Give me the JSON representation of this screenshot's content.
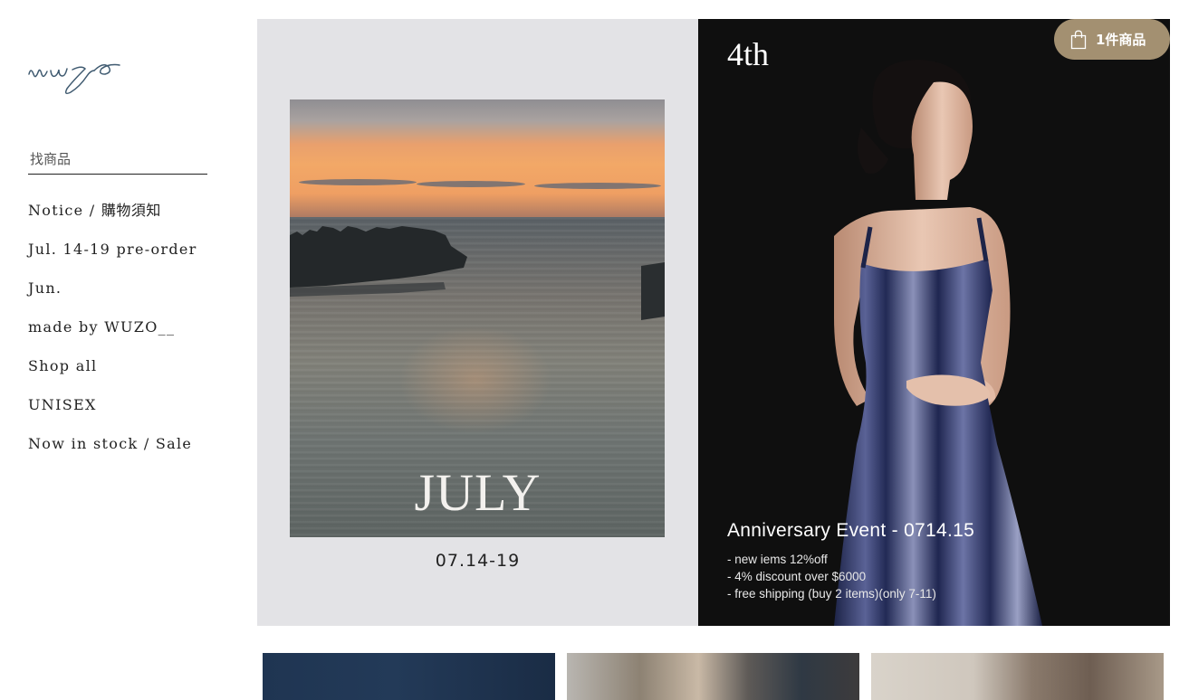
{
  "brand": {
    "logo_text": "wuzo"
  },
  "search": {
    "placeholder": "找商品"
  },
  "nav": {
    "items": [
      {
        "label": "Notice / ",
        "label_cjk": "購物須知"
      },
      {
        "label": "Jul. 14-19 pre-order"
      },
      {
        "label": "Jun."
      },
      {
        "label": "made by WUZO__"
      },
      {
        "label": "Shop all"
      },
      {
        "label": "UNISEX"
      },
      {
        "label": "Now in stock / Sale"
      }
    ]
  },
  "cart": {
    "label": "1件商品",
    "icon": "shopping-bag-icon",
    "color": "#a39071"
  },
  "hero": {
    "left": {
      "title": "JULY",
      "date": "07.14-19",
      "background": "#e3e3e6"
    },
    "right": {
      "badge": "4th",
      "event_title": "Anniversary Event  - 0714.15",
      "bullets": [
        "- new iems 12%off",
        "- 4% discount over $6000",
        "- free shipping (buy 2 items)(only 7-11)"
      ]
    }
  },
  "products": [
    {
      "name": "product-thumbnail-1"
    },
    {
      "name": "product-thumbnail-2"
    },
    {
      "name": "product-thumbnail-3"
    }
  ]
}
